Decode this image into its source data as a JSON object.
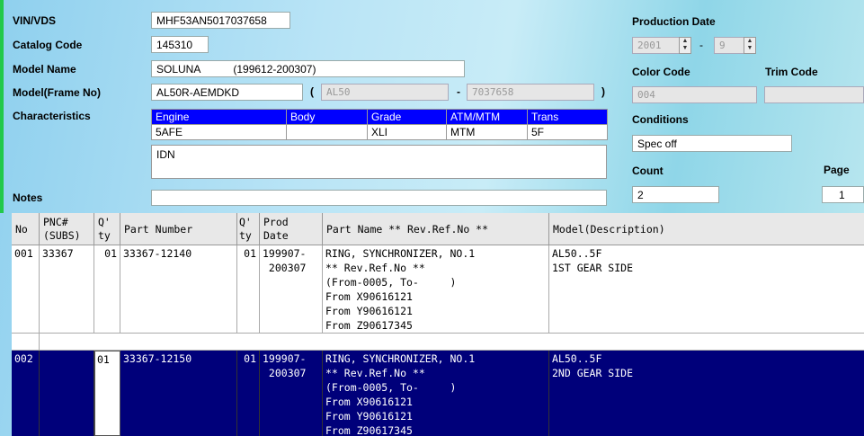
{
  "labels": {
    "vin": "VIN/VDS",
    "catalog": "Catalog Code",
    "model_name": "Model Name",
    "model_frame": "Model(Frame No)",
    "characteristics": "Characteristics",
    "notes": "Notes",
    "production_date": "Production Date",
    "color_code": "Color Code",
    "trim_code": "Trim Code",
    "conditions": "Conditions",
    "count": "Count",
    "page": "Page"
  },
  "fields": {
    "vin": "MHF53AN5017037658",
    "catalog": "145310",
    "model_name": "SOLUNA           (199612-200307)",
    "model_frame": "AL50R-AEMDKD",
    "frame_part1": "AL50",
    "frame_part2": "7037658",
    "prod_year": "2001",
    "prod_month": "9",
    "color_code": "004",
    "trim_code": "",
    "conditions": "Spec off",
    "count": "2",
    "page": "1",
    "notes": "",
    "idn": "IDN"
  },
  "punct": {
    "open": "(",
    "dash": "-",
    "close": ")",
    "date_dash": "-"
  },
  "characteristics": {
    "headers": [
      "Engine",
      "Body",
      "Grade",
      "ATM/MTM",
      "Trans"
    ],
    "values": [
      "5AFE",
      "",
      "XLI",
      "MTM",
      "5F"
    ]
  },
  "table": {
    "headers": {
      "no": "No",
      "pnc": "PNC#\n(SUBS)",
      "qty1": "Q'\nty",
      "part_number": "Part Number",
      "qty2": "Q'\nty",
      "prod_date": "Prod\nDate",
      "part_name": "Part Name ** Rev.Ref.No **",
      "model": "Model(Description)"
    },
    "rows": [
      {
        "no": "001",
        "pnc": "33367",
        "qty1": "01",
        "part_number": "33367-12140",
        "qty2": "01",
        "prod_date": "199907-\n 200307",
        "part_name": "RING, SYNCHRONIZER, NO.1\n** Rev.Ref.No **\n(From-0005, To-     )\nFrom X90616121\nFrom Y90616121\nFrom Z90617345",
        "model": "AL50..5F\n1ST GEAR SIDE"
      },
      {
        "no": "002",
        "pnc": "",
        "qty1": "01",
        "part_number": "33367-12150",
        "qty2": "01",
        "prod_date": "199907-\n 200307",
        "part_name": "RING, SYNCHRONIZER, NO.1\n** Rev.Ref.No **\n(From-0005, To-     )\nFrom X90616121\nFrom Y90616121\nFrom Z90617345",
        "model": "AL50..5F\n2ND GEAR SIDE"
      }
    ]
  }
}
